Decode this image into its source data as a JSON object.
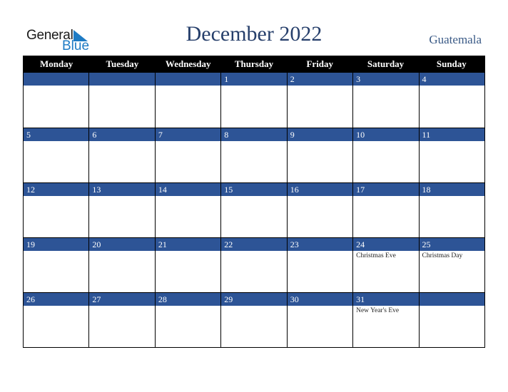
{
  "logo": {
    "word1": "General",
    "word2": "Blue"
  },
  "header": {
    "title": "December 2022",
    "country": "Guatemala"
  },
  "colors": {
    "header_bg": "#000000",
    "date_bar": "#2d5496",
    "title": "#263f6b",
    "logo_blue": "#1e7bc4"
  },
  "weekdays": [
    "Monday",
    "Tuesday",
    "Wednesday",
    "Thursday",
    "Friday",
    "Saturday",
    "Sunday"
  ],
  "weeks": [
    [
      {
        "day": ""
      },
      {
        "day": ""
      },
      {
        "day": ""
      },
      {
        "day": "1"
      },
      {
        "day": "2"
      },
      {
        "day": "3"
      },
      {
        "day": "4"
      }
    ],
    [
      {
        "day": "5"
      },
      {
        "day": "6"
      },
      {
        "day": "7"
      },
      {
        "day": "8"
      },
      {
        "day": "9"
      },
      {
        "day": "10"
      },
      {
        "day": "11"
      }
    ],
    [
      {
        "day": "12"
      },
      {
        "day": "13"
      },
      {
        "day": "14"
      },
      {
        "day": "15"
      },
      {
        "day": "16"
      },
      {
        "day": "17"
      },
      {
        "day": "18"
      }
    ],
    [
      {
        "day": "19"
      },
      {
        "day": "20"
      },
      {
        "day": "21"
      },
      {
        "day": "22"
      },
      {
        "day": "23"
      },
      {
        "day": "24",
        "event": "Christmas Eve"
      },
      {
        "day": "25",
        "event": "Christmas Day"
      }
    ],
    [
      {
        "day": "26"
      },
      {
        "day": "27"
      },
      {
        "day": "28"
      },
      {
        "day": "29"
      },
      {
        "day": "30"
      },
      {
        "day": "31",
        "event": "New Year's Eve"
      },
      {
        "day": ""
      }
    ]
  ]
}
